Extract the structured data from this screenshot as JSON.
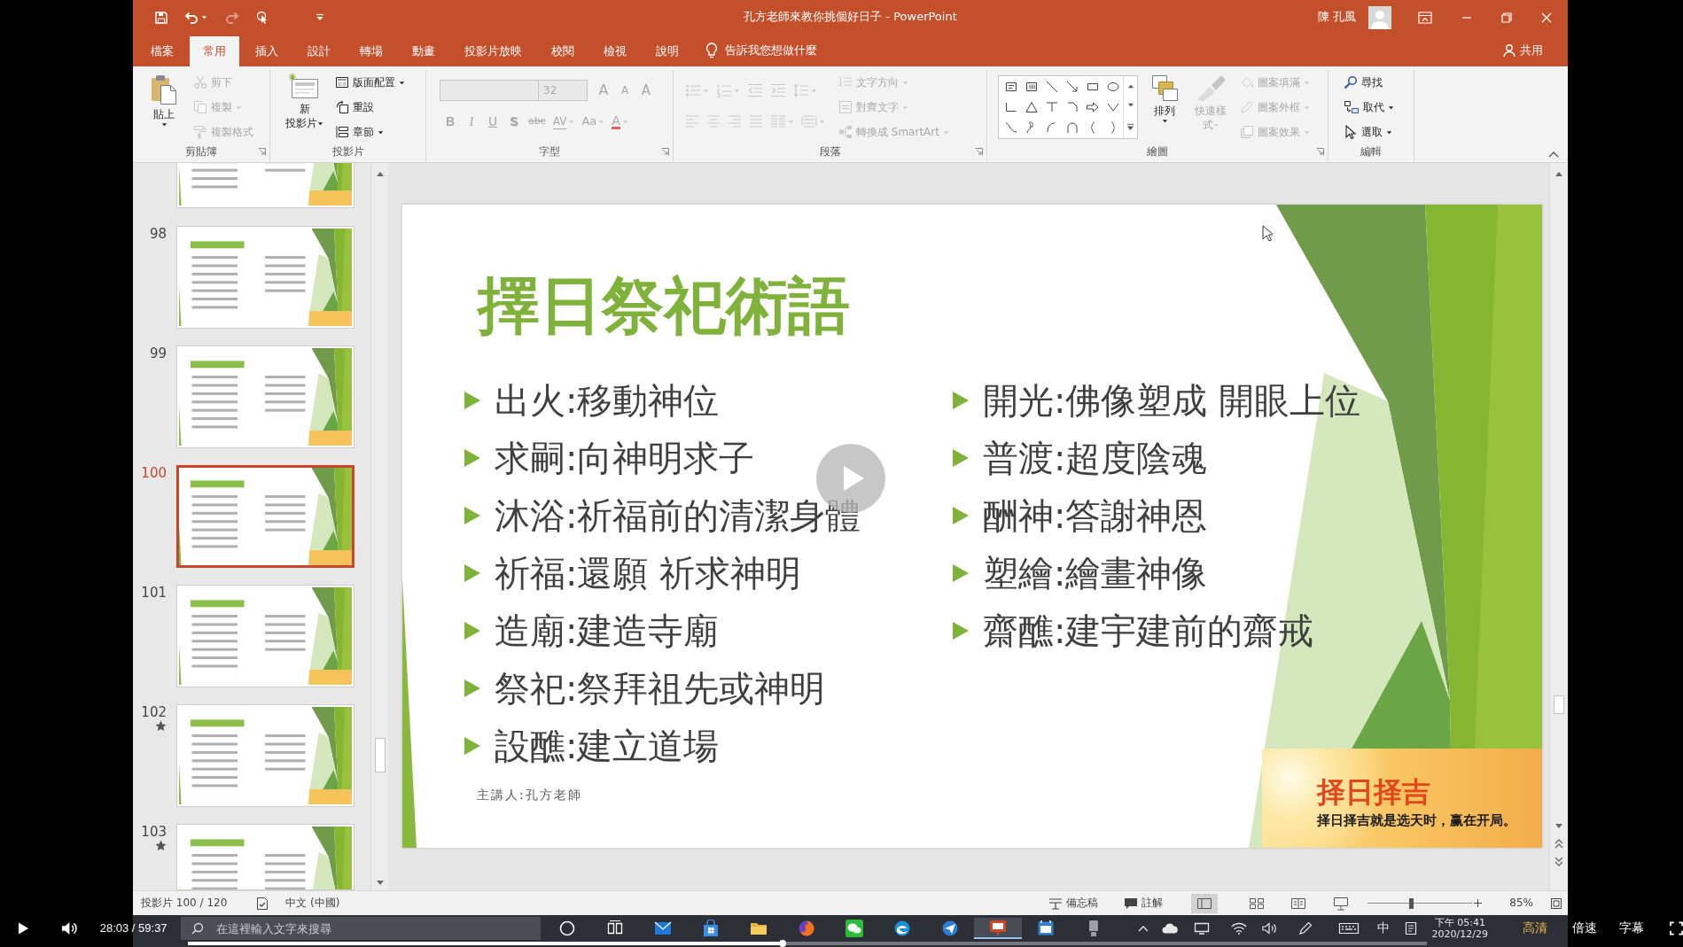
{
  "window": {
    "title": "孔方老師來教你挑個好日子 - PowerPoint",
    "user": "陳 孔風"
  },
  "tabs": [
    {
      "label": "檔案",
      "selected": false
    },
    {
      "label": "常用",
      "selected": true
    },
    {
      "label": "插入",
      "selected": false
    },
    {
      "label": "設計",
      "selected": false
    },
    {
      "label": "轉場",
      "selected": false
    },
    {
      "label": "動畫",
      "selected": false
    },
    {
      "label": "投影片放映",
      "selected": false
    },
    {
      "label": "校閱",
      "selected": false
    },
    {
      "label": "檢視",
      "selected": false
    },
    {
      "label": "說明",
      "selected": false
    }
  ],
  "tell_me": "告訴我您想做什麼",
  "share": "共用",
  "ribbon": {
    "groups": [
      {
        "label": "剪貼簿",
        "launcher": true,
        "items": [
          {
            "kind": "paste",
            "label": "貼上",
            "dropdown": true,
            "disabled": false
          },
          {
            "kind": "cut",
            "label": "剪下",
            "dropdown": false,
            "disabled": true
          },
          {
            "kind": "copy",
            "label": "複製",
            "dropdown": true,
            "disabled": true
          },
          {
            "kind": "painter",
            "label": "複製格式",
            "dropdown": false,
            "disabled": true
          }
        ]
      },
      {
        "label": "投影片",
        "launcher": false,
        "items": [
          {
            "kind": "newslide",
            "lines": [
              "新",
              "投影片"
            ],
            "dropdown": true,
            "disabled": false
          },
          {
            "kind": "layout",
            "label": "版面配置",
            "dropdown": true,
            "disabled": false
          },
          {
            "kind": "reset",
            "label": "重設",
            "dropdown": false,
            "disabled": false
          },
          {
            "kind": "section",
            "label": "章節",
            "dropdown": true,
            "disabled": false
          }
        ]
      },
      {
        "label": "字型",
        "launcher": true,
        "rows": [
          [
            {
              "kind": "fontname",
              "disabled": true
            },
            {
              "kind": "fontsize",
              "value": "32",
              "disabled": true
            },
            {
              "kind": "grow",
              "label": "A",
              "dropdown": false,
              "disabled": true
            },
            {
              "kind": "shrink",
              "label": "A",
              "dropdown": false,
              "disabled": true
            },
            {
              "kind": "clear",
              "label": "A",
              "dropdown": false,
              "disabled": true
            }
          ],
          [
            {
              "kind": "bold",
              "label": "B",
              "dropdown": false,
              "disabled": true
            },
            {
              "kind": "italic",
              "label": "I",
              "dropdown": false,
              "disabled": true
            },
            {
              "kind": "underline",
              "label": "U",
              "dropdown": false,
              "disabled": true
            },
            {
              "kind": "shadow",
              "label": "S",
              "dropdown": false,
              "disabled": true
            },
            {
              "kind": "strike",
              "label": "abc",
              "dropdown": false,
              "disabled": true
            },
            {
              "kind": "spacing",
              "label": "AV",
              "dropdown": true,
              "disabled": true
            },
            {
              "kind": "case",
              "label": "Aa",
              "dropdown": true,
              "disabled": true
            },
            {
              "kind": "color",
              "label": "A",
              "dropdown": true,
              "disabled": true
            }
          ]
        ]
      },
      {
        "label": "段落",
        "launcher": true,
        "rows": [
          [
            {
              "kind": "bullets",
              "dropdown": true,
              "disabled": true
            },
            {
              "kind": "numbering",
              "dropdown": true,
              "disabled": true
            },
            {
              "kind": "outdent",
              "dropdown": false,
              "disabled": true
            },
            {
              "kind": "indent",
              "dropdown": false,
              "disabled": true
            },
            {
              "kind": "linespacing",
              "dropdown": true,
              "disabled": true
            }
          ],
          [
            {
              "kind": "left",
              "dropdown": false,
              "disabled": true
            },
            {
              "kind": "center",
              "dropdown": false,
              "disabled": true
            },
            {
              "kind": "right",
              "dropdown": false,
              "disabled": true
            },
            {
              "kind": "justify",
              "dropdown": false,
              "disabled": true
            },
            {
              "kind": "columns",
              "dropdown": true,
              "disabled": true
            },
            {
              "kind": "distribute",
              "dropdown": true,
              "disabled": true
            }
          ]
        ],
        "items": [
          {
            "kind": "direction",
            "label": "文字方向",
            "dropdown": true,
            "disabled": true
          },
          {
            "kind": "align",
            "label": "對齊文字",
            "dropdown": true,
            "disabled": true
          },
          {
            "kind": "smartart",
            "label": "轉換成 SmartArt",
            "dropdown": true,
            "disabled": true
          }
        ]
      },
      {
        "label": "繪圖",
        "launcher": true,
        "items": [
          {
            "kind": "gallery",
            "disabled": false
          },
          {
            "kind": "arrange",
            "label": "排列",
            "dropdown": true,
            "disabled": false
          },
          {
            "kind": "styles",
            "lines": [
              "快速樣",
              "式"
            ],
            "dropdown": true,
            "disabled": true
          },
          {
            "kind": "fill",
            "label": "圖案填滿",
            "dropdown": true,
            "disabled": true
          },
          {
            "kind": "outline",
            "label": "圖案外框",
            "dropdown": true,
            "disabled": true
          },
          {
            "kind": "effects",
            "label": "圖案效果",
            "dropdown": true,
            "disabled": true
          }
        ]
      },
      {
        "label": "編輯",
        "launcher": false,
        "items": [
          {
            "kind": "find",
            "label": "尋找",
            "dropdown": false,
            "disabled": false
          },
          {
            "kind": "replace",
            "label": "取代",
            "dropdown": true,
            "disabled": false
          },
          {
            "kind": "select",
            "label": "選取",
            "dropdown": true,
            "disabled": false
          }
        ]
      }
    ]
  },
  "thumbnails": [
    {
      "selected": false,
      "starred": false
    },
    {
      "number": "98",
      "selected": false,
      "starred": false
    },
    {
      "number": "99",
      "selected": false,
      "starred": false
    },
    {
      "number": "100",
      "selected": true,
      "starred": false
    },
    {
      "number": "101",
      "selected": false,
      "starred": false
    },
    {
      "number": "102",
      "selected": false,
      "starred": true
    },
    {
      "number": "103",
      "selected": false,
      "starred": true
    }
  ],
  "slide": {
    "title": "擇日祭祀術語",
    "columns": [
      {
        "items": [
          "出火:移動神位",
          "求嗣:向神明求子",
          "沐浴:祈福前的清潔身體",
          "祈福:還願 祈求神明",
          "造廟:建造寺廟",
          "祭祀:祭拜祖先或神明",
          "設醮:建立道場"
        ]
      },
      {
        "items": [
          "開光:佛像塑成 開眼上位",
          "普渡:超度陰魂",
          "酬神:答謝神恩",
          "塑繪:繪畫神像",
          "齋醮:建宇建前的齋戒"
        ]
      }
    ],
    "presenter": "主講人:孔方老師",
    "logo": {
      "title": "择日择吉",
      "tagline": "择日择吉就是选天时，赢在开局。"
    }
  },
  "status_bar": {
    "slide_counter": "投影片 100 / 120",
    "language": "中文 (中國)",
    "notes": "備忘稿",
    "comments": "註解",
    "views": [
      {
        "selected": true
      },
      {
        "selected": false
      },
      {
        "selected": false
      },
      {
        "selected": false
      }
    ],
    "zoom": {
      "level": 0.41,
      "value": "85%"
    }
  },
  "taskbar": {
    "search": {
      "placeholder": "在這裡輸入文字來搜尋"
    },
    "apps": [
      {
        "active": false
      },
      {
        "active": false
      },
      {
        "active": false
      },
      {
        "active": false
      },
      {
        "active": false
      },
      {
        "active": false
      },
      {
        "active": false
      },
      {
        "active": false
      },
      {
        "active": false
      },
      {
        "active": true
      },
      {
        "active": false
      },
      {
        "active": false
      }
    ],
    "ime": "中",
    "time": "下午 05:41",
    "date": "2020/12/29"
  },
  "video": {
    "paused": true,
    "time": "28:03 / 59:37",
    "progress": {
      "level": 0.48
    },
    "options": [
      {
        "label": "高清",
        "selected": true
      },
      {
        "label": "倍速",
        "selected": false
      },
      {
        "label": "字幕",
        "selected": false
      }
    ]
  }
}
